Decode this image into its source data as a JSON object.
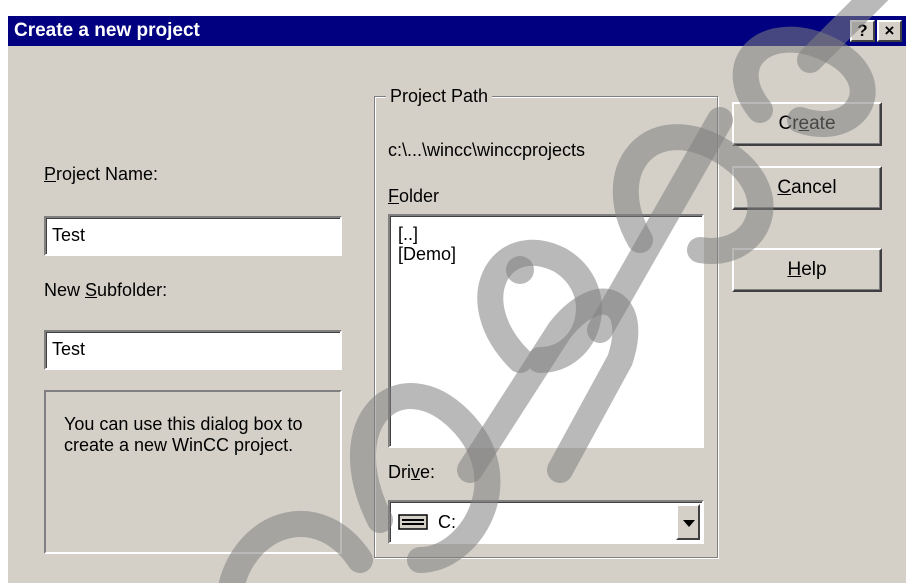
{
  "window": {
    "title": "Create a new project",
    "help_button": "?",
    "close_button": "×"
  },
  "form": {
    "project_name_label": {
      "pre": "",
      "key": "P",
      "post": "roject Name:"
    },
    "project_name_value": "Test",
    "subfolder_label": {
      "pre": "New ",
      "key": "S",
      "post": "ubfolder:"
    },
    "subfolder_value": "Test",
    "info_text": "You can use this dialog box to create a new WinCC project."
  },
  "project_path": {
    "group_title": "Project Path",
    "path": "c:\\...\\wincc\\winccprojects",
    "folder_label": {
      "pre": "",
      "key": "F",
      "post": "older"
    },
    "folders": [
      "[..]",
      "[Demo]"
    ],
    "drive_label": {
      "pre": "Dri",
      "key": "v",
      "post": "e:"
    },
    "drive_value": "C:",
    "drive_icon": "drive-icon"
  },
  "buttons": {
    "create": {
      "pre": "Cr",
      "key": "e",
      "post": "ate"
    },
    "cancel": {
      "pre": "",
      "key": "C",
      "post": "ancel"
    },
    "help": {
      "pre": "",
      "key": "H",
      "post": "elp"
    }
  },
  "colors": {
    "titlebar": "#000080",
    "face": "#d4d0c8"
  }
}
